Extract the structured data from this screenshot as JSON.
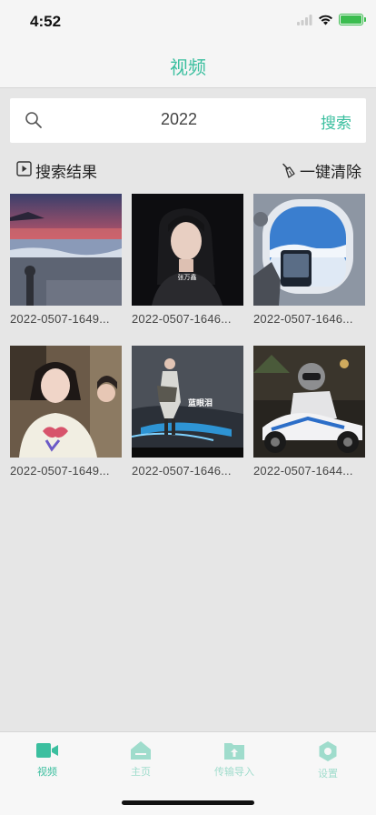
{
  "status": {
    "time": "4:52"
  },
  "nav": {
    "title": "视频"
  },
  "search": {
    "value": "2022",
    "button_label": "搜索"
  },
  "results": {
    "label": "搜索结果",
    "clear_label": "一键清除"
  },
  "videos": [
    {
      "title": "2022-0507-1649...",
      "thumb": "sunset-beach"
    },
    {
      "title": "2022-0507-1646...",
      "thumb": "girl-dark",
      "caption": "张万鑫"
    },
    {
      "title": "2022-0507-1646...",
      "thumb": "airplane-window"
    },
    {
      "title": "2022-0507-1649...",
      "thumb": "girl-tshirt"
    },
    {
      "title": "2022-0507-1646...",
      "thumb": "girl-bluelight",
      "caption": "蓝眼泪"
    },
    {
      "title": "2022-0507-1644...",
      "thumb": "motorcycle-night"
    }
  ],
  "tabs": [
    {
      "label": "视频",
      "icon": "video-camera-icon",
      "active": true
    },
    {
      "label": "主页",
      "icon": "home-icon",
      "active": false
    },
    {
      "label": "传输导入",
      "icon": "upload-folder-icon",
      "active": false
    },
    {
      "label": "设置",
      "icon": "settings-icon",
      "active": false
    }
  ],
  "colors": {
    "accent": "#3bbf9f",
    "accent_light": "#9fdccc",
    "background": "#e6e6e6"
  }
}
